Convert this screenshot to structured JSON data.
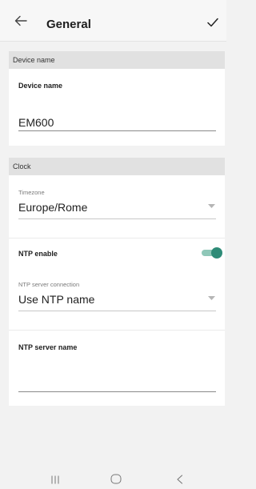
{
  "header": {
    "title": "General",
    "back_icon": "arrow-left-icon",
    "confirm_icon": "checkmark-icon"
  },
  "device_section": {
    "header": "Device name",
    "field_label": "Device name",
    "field_value": "EM600"
  },
  "clock_section": {
    "header": "Clock",
    "timezone_label": "Timezone",
    "timezone_value": "Europe/Rome",
    "ntp_enable_label": "NTP enable",
    "ntp_enable_on": true,
    "ntp_connection_label": "NTP server connection",
    "ntp_connection_value": "Use NTP name",
    "ntp_server_name_label": "NTP server name",
    "ntp_server_name_value": ""
  },
  "navbar": {
    "recents_icon": "recents-icon",
    "home_icon": "home-icon",
    "back_icon": "back-icon"
  },
  "colors": {
    "accent": "#2e8b77",
    "section_header_bg": "#e1e1e1",
    "page_bg": "#f2f2f2"
  }
}
